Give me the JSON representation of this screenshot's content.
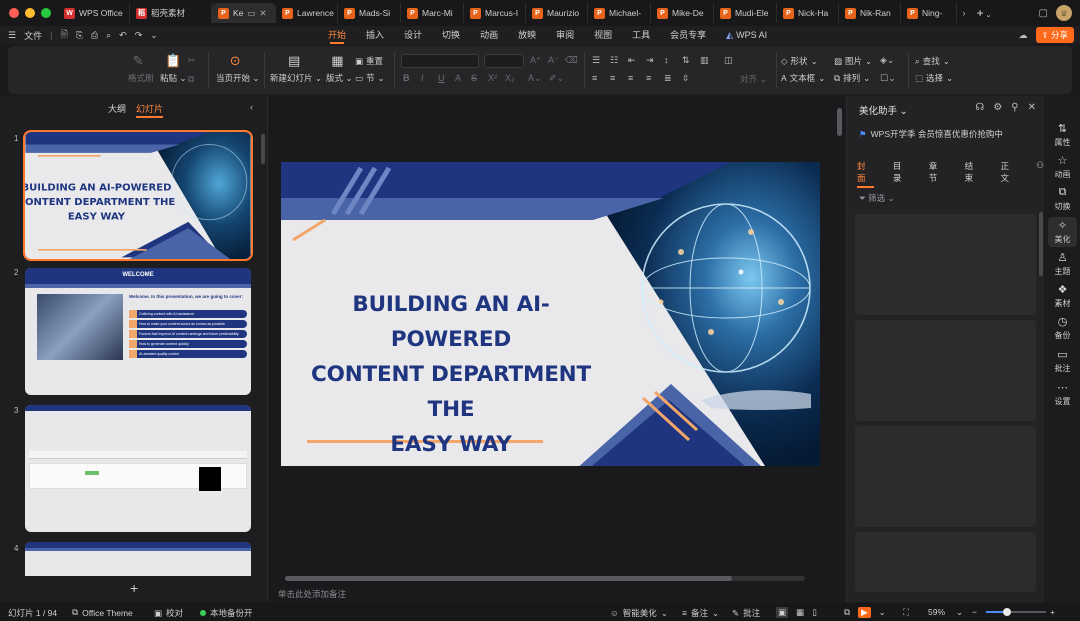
{
  "tabbar": {
    "tabs": [
      {
        "label": "WPS Office",
        "icon": "wps-logo-icon"
      },
      {
        "label": "稻壳素材",
        "icon": "docer-icon"
      },
      {
        "label": "Ke",
        "icon": "ppt-file-icon",
        "active": true
      },
      {
        "label": "Lawrence",
        "icon": "ppt-file-icon"
      },
      {
        "label": "Mads-Si",
        "icon": "ppt-file-icon"
      },
      {
        "label": "Marc-Mi",
        "icon": "ppt-file-icon"
      },
      {
        "label": "Marcus-I",
        "icon": "ppt-file-icon"
      },
      {
        "label": "Maurizio",
        "icon": "ppt-file-icon"
      },
      {
        "label": "Michael-",
        "icon": "ppt-file-icon"
      },
      {
        "label": "Mike-De",
        "icon": "ppt-file-icon"
      },
      {
        "label": "Mudi-Ele",
        "icon": "ppt-file-icon"
      },
      {
        "label": "Nick-Ha",
        "icon": "ppt-file-icon"
      },
      {
        "label": "Nik-Ran",
        "icon": "ppt-file-icon"
      },
      {
        "label": "Ning-",
        "icon": "ppt-file-icon"
      }
    ],
    "new_tab": "+"
  },
  "menubar": {
    "file": "文件",
    "tabs": [
      "开始",
      "插入",
      "设计",
      "切换",
      "动画",
      "放映",
      "审阅",
      "视图",
      "工具",
      "会员专享",
      "WPS AI"
    ],
    "active_tab": "开始",
    "share": "分享"
  },
  "ribbon": {
    "format_painter": "格式刷",
    "paste": "粘贴",
    "play_from_current": "当页开始",
    "new_slide": "新建幻灯片",
    "layout": "版式",
    "section": "节",
    "reset": "重置",
    "align": "对齐",
    "shape": "形状",
    "picture": "图片",
    "textbox": "文本框",
    "arrange": "排列",
    "find": "查找",
    "select": "选择"
  },
  "left_panel": {
    "tab_outline": "大纲",
    "tab_slides": "幻灯片",
    "slides": [
      {
        "num": "1",
        "title": "BUILDING AN AI-POWERED CONTENT DEPARTMENT THE EASY WAY"
      },
      {
        "num": "2",
        "heading": "WELCOME",
        "intro": "Welcome. In this presentation, we are going to cover:",
        "bullets": [
          "Outlining content with AI assistance",
          "How to make your content sound as human as possible",
          "Factors that improve AI content rankings and future predictability",
          "How to generate content quickly",
          "AI-assisted quality control"
        ]
      },
      {
        "num": "3"
      },
      {
        "num": "4"
      }
    ],
    "add": "+"
  },
  "slide": {
    "title_lines": [
      "BUILDING AN AI-POWERED",
      "CONTENT DEPARTMENT THE",
      "EASY WAY"
    ]
  },
  "notes": "单击此处添加备注",
  "assistant": {
    "title": "美化助手",
    "promo": "WPS开学季 会员惊喜优惠价抢购中",
    "tabs": [
      "封面",
      "目录",
      "章节",
      "结束",
      "正文"
    ],
    "active_tab": "封面",
    "filter": "筛选"
  },
  "sidebar": {
    "items": [
      "属性",
      "动画",
      "切换",
      "美化",
      "主题",
      "素材",
      "备份",
      "批注",
      "设置"
    ],
    "active": "美化"
  },
  "statusbar": {
    "slide_counter": "幻灯片 1 / 94",
    "theme": "Office Theme",
    "proofread": "校对",
    "backup": "本地备份开",
    "smart_beautify": "智能美化",
    "notes": "备注",
    "comments": "批注",
    "zoom": "59%",
    "zoom_level": 0.35
  },
  "colors": {
    "accent": "#ff7a2e",
    "slide_navy": "#1f3580",
    "slide_orange": "#f2a66a"
  }
}
